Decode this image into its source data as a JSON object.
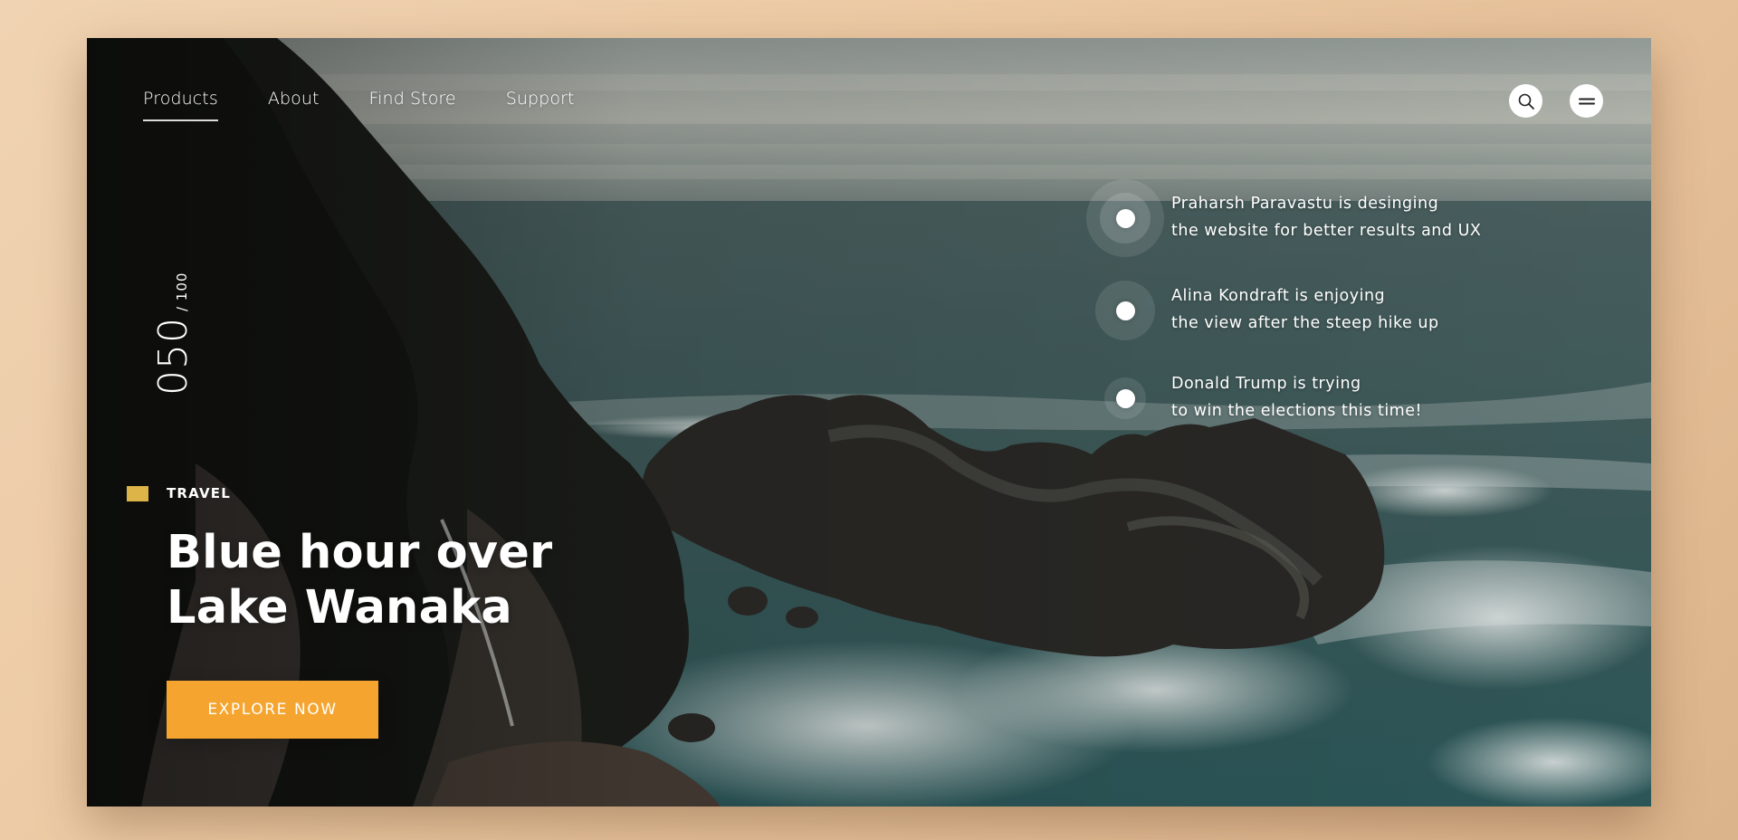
{
  "nav": {
    "items": [
      {
        "label": "Products",
        "active": true
      },
      {
        "label": "About",
        "active": false
      },
      {
        "label": "Find Store",
        "active": false
      },
      {
        "label": "Support",
        "active": false
      }
    ]
  },
  "actions": {
    "search_icon": "search-icon",
    "menu_icon": "menu-icon"
  },
  "counter": {
    "current": "050",
    "total": "/ 100"
  },
  "hero": {
    "category": "TRAVEL",
    "category_color": "#dcb448",
    "title_line1": "Blue hour over",
    "title_line2": "Lake Wanaka",
    "cta_label": "EXPLORE NOW",
    "cta_color": "#f5a52f"
  },
  "feed": [
    {
      "line1": "Praharsh Paravastu is desinging",
      "line2": "the website for better results and UX"
    },
    {
      "line1": "Alina Kondraft is enjoying",
      "line2": "the view after the steep hike up"
    },
    {
      "line1": "Donald Trump is trying",
      "line2": "to win the elections this time!"
    }
  ]
}
